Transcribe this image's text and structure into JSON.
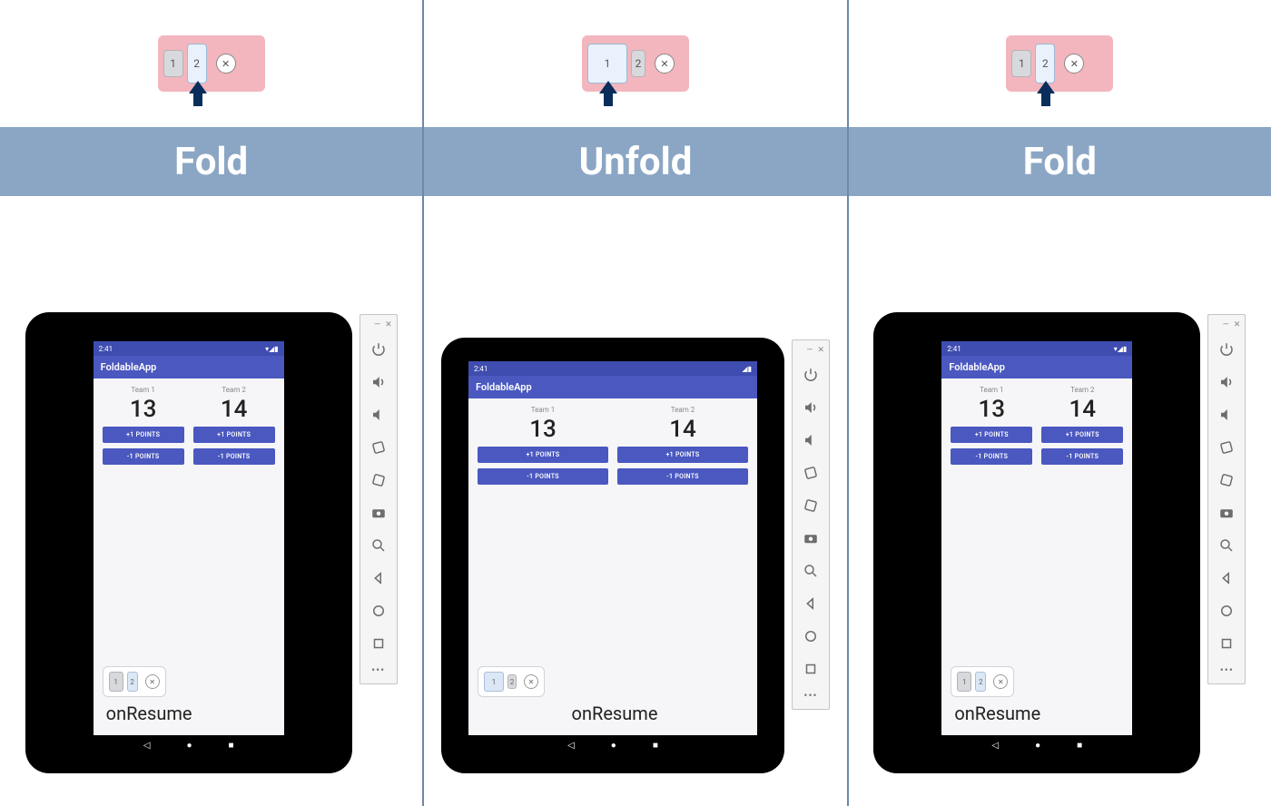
{
  "columns": [
    {
      "title": "Fold",
      "topWidget": {
        "selected": 2
      }
    },
    {
      "title": "Unfold",
      "topWidget": {
        "selected": 1
      }
    },
    {
      "title": "Fold",
      "topWidget": {
        "selected": 2
      }
    }
  ],
  "app": {
    "name": "FoldableApp",
    "statusTime": "2:41",
    "team1Label": "Team 1",
    "team2Label": "Team 2",
    "score1": "13",
    "score2": "14",
    "plusBtn": "+1 POINTS",
    "minusBtn": "-1 POINTS",
    "lifecycleText": "onResume",
    "smallWidget": {
      "key1": "1",
      "key2": "2",
      "close": "✕"
    }
  },
  "foldWidget": {
    "key1": "1",
    "key2": "2",
    "close": "✕"
  },
  "emulatorToolbar": {
    "minimize": "—",
    "close": "✕",
    "buttons": [
      "power",
      "vol-up",
      "vol-down",
      "rotate-left",
      "rotate-right",
      "camera",
      "zoom",
      "back",
      "home",
      "square"
    ],
    "more": "•••"
  }
}
